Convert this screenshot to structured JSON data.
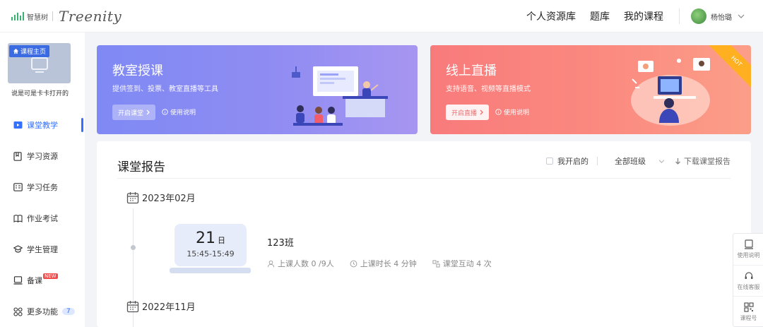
{
  "brand": {
    "cn": "智慧树",
    "en": "Treenity",
    "bar_color": "#3bb273"
  },
  "nav": {
    "items": [
      "个人资源库",
      "题库",
      "我的课程"
    ],
    "user_name": "杨怡璐"
  },
  "sidebar": {
    "course_badge": "课程主页",
    "course_name": "说是可是卡卡打开的",
    "items": [
      {
        "label": "课堂教学",
        "icon": "classroom-icon",
        "active": true
      },
      {
        "label": "学习资源",
        "icon": "resource-icon"
      },
      {
        "label": "学习任务",
        "icon": "task-icon"
      },
      {
        "label": "作业考试",
        "icon": "exam-icon"
      },
      {
        "label": "学生管理",
        "icon": "student-icon"
      },
      {
        "label": "备课",
        "icon": "prepare-icon",
        "badge": "NEW"
      },
      {
        "label": "更多功能",
        "icon": "more-icon",
        "count": "7"
      }
    ],
    "accent": "#3370ff"
  },
  "banners": [
    {
      "title": "教室授课",
      "desc": "提供签到、投票、教室直播等工具",
      "button": "开启课堂",
      "help": "使用说明",
      "color": "#8a8cf3"
    },
    {
      "title": "线上直播",
      "desc": "支持语音、视频等直播模式",
      "button": "开启直播",
      "help": "使用说明",
      "ribbon": "HOT",
      "color": "#f98580"
    }
  ],
  "report": {
    "title": "课堂报告",
    "filter_mine": "我开启的",
    "class_select": "全部班级",
    "download": "下载课堂报告",
    "months": [
      "2023年02月",
      "2022年11月"
    ],
    "session": {
      "day": "21",
      "day_unit": "日",
      "time": "15:45-15:49",
      "name": "123班",
      "stats": [
        "上课人数 0 /9人",
        "上课时长 4 分钟",
        "课堂互动 4 次"
      ]
    }
  },
  "float_panel": {
    "items": [
      "使用说明",
      "在线客服",
      "课程号"
    ]
  }
}
